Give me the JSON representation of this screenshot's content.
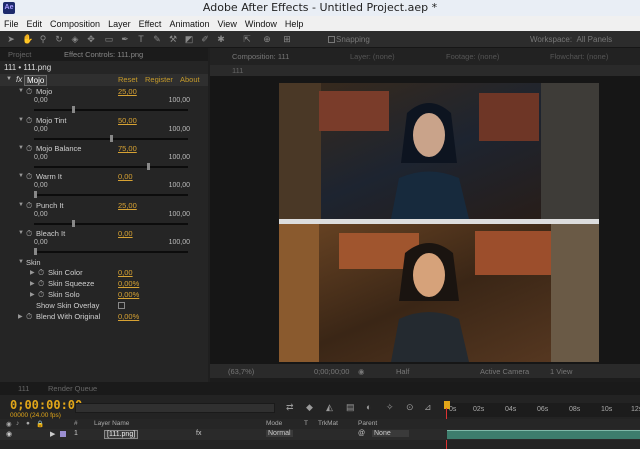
{
  "window": {
    "title": "Adobe After Effects - Untitled Project.aep *",
    "app_icon": "Ae"
  },
  "menu": [
    "File",
    "Edit",
    "Composition",
    "Layer",
    "Effect",
    "Animation",
    "View",
    "Window",
    "Help"
  ],
  "toolbar": {
    "snapping_label": "Snapping",
    "workspace_label": "Workspace:",
    "workspace_value": "All Panels"
  },
  "left_panel": {
    "tabs": [
      "Project",
      "Effect Controls: 111.png"
    ],
    "header": "111 • 111.png",
    "effect": {
      "name": "Mojo",
      "reset": "Reset",
      "register": "Register",
      "about": "About"
    },
    "properties": [
      {
        "name": "Mojo",
        "value": "25,00",
        "min": "0,00",
        "max": "100,00",
        "level": 0.25
      },
      {
        "name": "Mojo Tint",
        "value": "50,00",
        "min": "0,00",
        "max": "100,00",
        "level": 0.5
      },
      {
        "name": "Mojo Balance",
        "value": "75,00",
        "min": "0,00",
        "max": "100,00",
        "level": 0.75
      },
      {
        "name": "Warm It",
        "value": "0,00",
        "min": "0,00",
        "max": "100,00",
        "level": 0.0
      },
      {
        "name": "Punch It",
        "value": "25,00",
        "min": "0,00",
        "max": "100,00",
        "level": 0.25
      },
      {
        "name": "Bleach It",
        "value": "0,00",
        "min": "0,00",
        "max": "100,00",
        "level": 0.0
      }
    ],
    "skin_group": {
      "name": "Skin",
      "items": [
        {
          "name": "Skin Color",
          "value": "0,00"
        },
        {
          "name": "Skin Squeeze",
          "value": "0,00%"
        },
        {
          "name": "Skin Solo",
          "value": "0,00%"
        }
      ],
      "overlay": "Show Skin Overlay"
    },
    "blend": {
      "name": "Blend With Original",
      "value": "0,00%"
    }
  },
  "composition": {
    "tabs": [
      "Composition: 111",
      "Layer: (none)",
      "Footage: (none)",
      "Flowchart: (none)"
    ],
    "breadcrumb": "111",
    "zoom": "(63,7%)",
    "time": "0;00;00;00",
    "resolution": "Half",
    "camera": "Active Camera",
    "views": "1 View"
  },
  "timeline": {
    "tabs": [
      "111",
      "Render Queue"
    ],
    "timecode": "0;00:00:00",
    "fps": "00000 (24.00 fps)",
    "ruler": [
      "0s",
      "02s",
      "04s",
      "06s",
      "08s",
      "10s",
      "12s"
    ],
    "columns": [
      "#",
      "Layer Name",
      "Mode",
      "T",
      "TrkMat",
      "Parent"
    ],
    "layer": {
      "index": "1",
      "name": "[111.png]",
      "mode": "Normal",
      "parent": "None"
    }
  }
}
